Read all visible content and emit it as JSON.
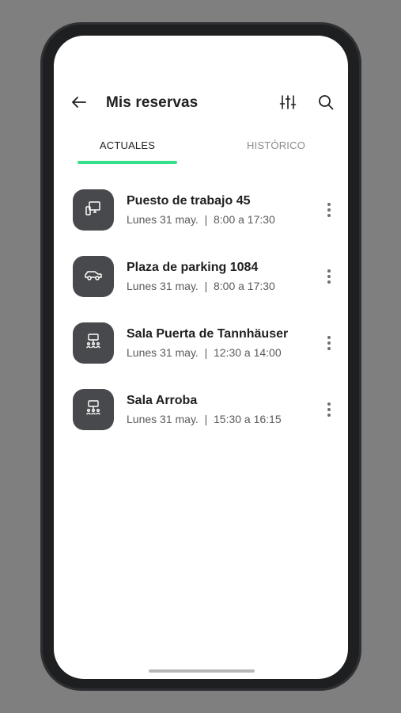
{
  "header": {
    "title": "Mis reservas",
    "back_icon": "arrow-left-icon",
    "filter_icon": "sliders-icon",
    "search_icon": "search-icon"
  },
  "tabs": [
    {
      "label": "ACTUALES",
      "active": true
    },
    {
      "label": "HISTÓRICO",
      "active": false
    }
  ],
  "colors": {
    "accent": "#35e08a",
    "icon_bg": "#48494c"
  },
  "reservations": [
    {
      "title": "Puesto de trabajo 45",
      "subtitle": "Lunes 31 may.  |  8:00 a 17:30",
      "icon": "workstation-icon"
    },
    {
      "title": "Plaza de parking 1084",
      "subtitle": "Lunes 31 may.  |  8:00 a 17:30",
      "icon": "car-icon"
    },
    {
      "title": "Sala Puerta de Tannhäuser",
      "subtitle": "Lunes 31 may.  |  12:30 a 14:00",
      "icon": "meeting-room-icon"
    },
    {
      "title": "Sala Arroba",
      "subtitle": "Lunes 31 may.  |  15:30 a 16:15",
      "icon": "meeting-room-icon"
    }
  ]
}
